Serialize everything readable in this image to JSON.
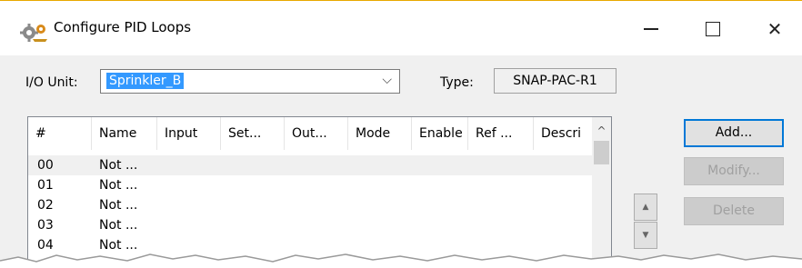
{
  "window": {
    "title": "Configure PID Loops",
    "icons": {
      "app": "gear-icon",
      "minimize": "minimize-icon",
      "maximize": "maximize-icon",
      "close": "close-icon"
    },
    "close_glyph": "✕"
  },
  "io_unit": {
    "label": "I/O Unit:",
    "value": "Sprinkler_B",
    "dropdown_icon": "chevron-down-icon",
    "dropdown_glyph": "⌵"
  },
  "type": {
    "label": "Type:",
    "value": "SNAP-PAC-R1"
  },
  "list": {
    "columns": [
      "#",
      "Name",
      "Input",
      "Set...",
      "Out...",
      "Mode",
      "Enable",
      "Ref ...",
      "Descri"
    ],
    "rows": [
      {
        "num": "00",
        "name": "Not ..."
      },
      {
        "num": "01",
        "name": "Not ..."
      },
      {
        "num": "02",
        "name": "Not ..."
      },
      {
        "num": "03",
        "name": "Not ..."
      },
      {
        "num": "04",
        "name": "Not ..."
      }
    ],
    "scroll_up_glyph": "^"
  },
  "buttons": {
    "add": "Add...",
    "modify": "Modify...",
    "delete": "Delete"
  },
  "order_buttons": {
    "up_glyph": "▲",
    "down_glyph": "▼"
  },
  "colors": {
    "selection": "#3399ff",
    "default_button_border": "#0078d7",
    "title_accent": "#e8a800"
  }
}
